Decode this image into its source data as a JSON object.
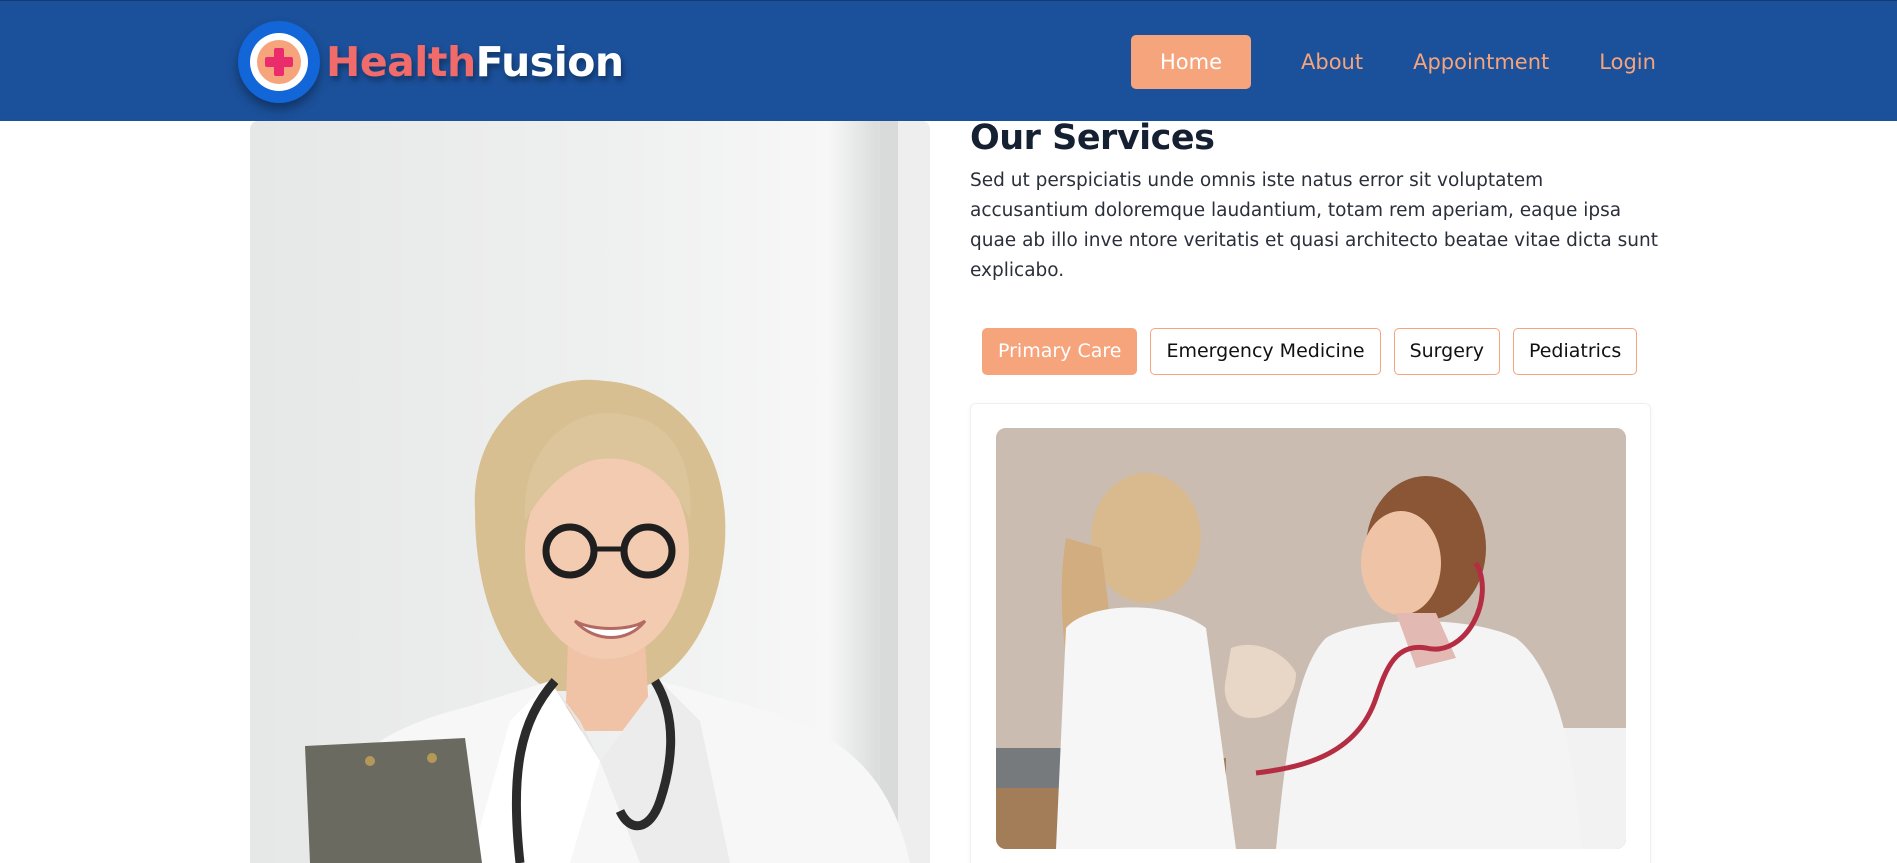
{
  "brand": {
    "name_part1": "Health",
    "name_part2": "Fusion"
  },
  "nav": {
    "items": [
      {
        "label": "Home",
        "active": true
      },
      {
        "label": "About",
        "active": false
      },
      {
        "label": "Appointment",
        "active": false
      },
      {
        "label": "Login",
        "active": false
      }
    ]
  },
  "services": {
    "title": "Our Services",
    "description": "Sed ut perspiciatis unde omnis iste natus error sit voluptatem accusantium doloremque laudantium, totam rem aperiam, eaque ipsa quae ab illo inve ntore veritatis et quasi architecto beatae vitae dicta sunt explicabo.",
    "tabs": [
      {
        "label": "Primary Care",
        "active": true
      },
      {
        "label": "Emergency Medicine",
        "active": false
      },
      {
        "label": "Surgery",
        "active": false
      },
      {
        "label": "Pediatrics",
        "active": false
      }
    ]
  },
  "colors": {
    "header_bg": "#1b509a",
    "accent": "#f6a47c",
    "brand_red": "#f26b6b",
    "logo_blue": "#1266d8",
    "logo_cross": "#ea2c6d"
  },
  "icons": {
    "logo": "medical-cross-icon"
  }
}
